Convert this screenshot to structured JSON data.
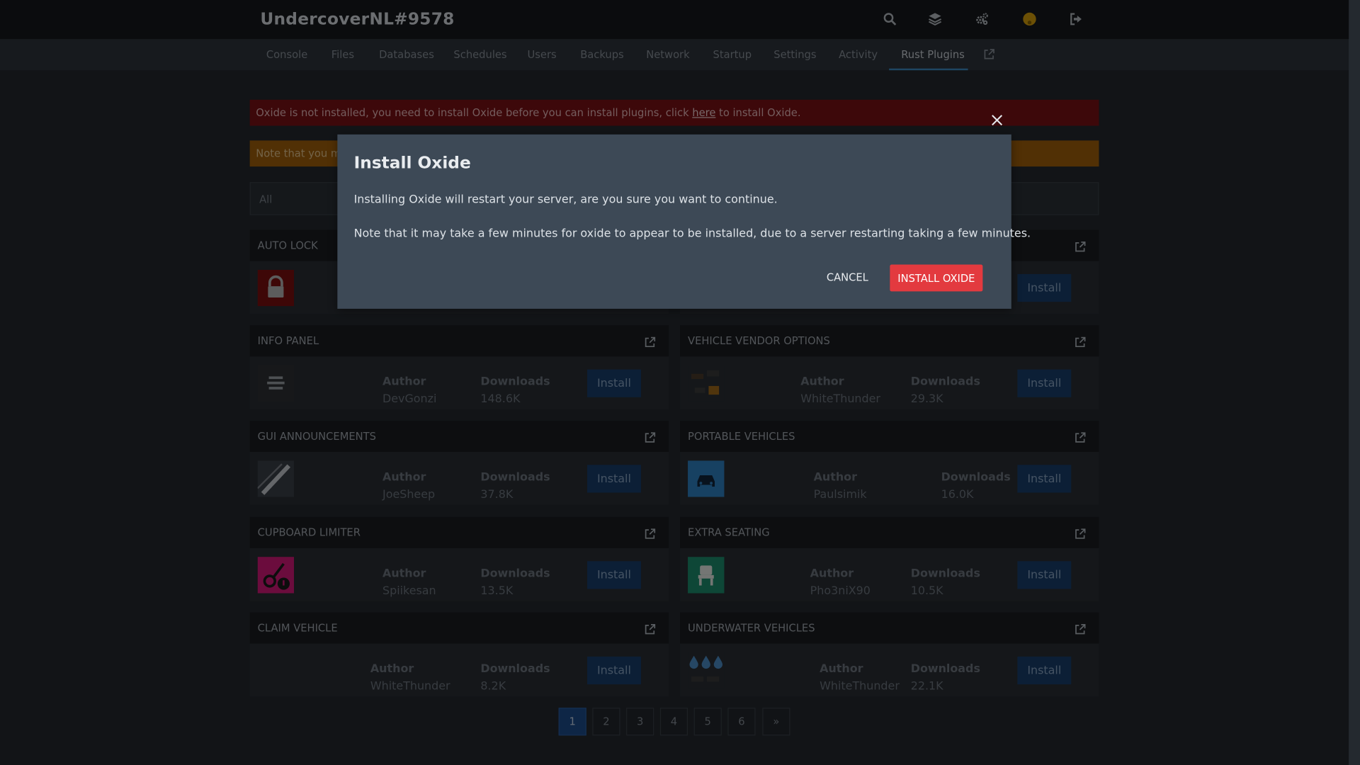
{
  "header": {
    "server_name": "UndercoverNL#9578"
  },
  "nav": {
    "tabs": [
      "Console",
      "Files",
      "Databases",
      "Schedules",
      "Users",
      "Backups",
      "Network",
      "Startup",
      "Settings",
      "Activity",
      "Rust Plugins"
    ],
    "active_tab": "Rust Plugins"
  },
  "alerts": {
    "oxide_before": "Oxide is not installed, you need to install Oxide before you can install plugins, click ",
    "oxide_link": "here",
    "oxide_after": " to install Oxide.",
    "note": "Note that you may"
  },
  "filter": {
    "value": "All"
  },
  "labels": {
    "author": "Author",
    "downloads": "Downloads",
    "install": "Install"
  },
  "plugins": [
    {
      "name": "AUTO LOCK",
      "author": "",
      "downloads": ""
    },
    {
      "name": "",
      "author": "",
      "downloads": ""
    },
    {
      "name": "INFO PANEL",
      "author": "DevGonzi",
      "downloads": "148.6K"
    },
    {
      "name": "VEHICLE VENDOR OPTIONS",
      "author": "WhiteThunder",
      "downloads": "29.3K"
    },
    {
      "name": "GUI ANNOUNCEMENTS",
      "author": "JoeSheep",
      "downloads": "37.8K"
    },
    {
      "name": "PORTABLE VEHICLES",
      "author": "Paulsimik",
      "downloads": "16.0K"
    },
    {
      "name": "CUPBOARD LIMITER",
      "author": "Spiikesan",
      "downloads": "13.5K"
    },
    {
      "name": "EXTRA SEATING",
      "author": "Pho3niX90",
      "downloads": "10.5K"
    },
    {
      "name": "CLAIM VEHICLE",
      "author": "WhiteThunder",
      "downloads": "8.2K"
    },
    {
      "name": "UNDERWATER VEHICLES",
      "author": "WhiteThunder",
      "downloads": "22.1K"
    }
  ],
  "pagination": {
    "pages": [
      "1",
      "2",
      "3",
      "4",
      "5",
      "6"
    ],
    "active": "1",
    "next_label": "»"
  },
  "modal": {
    "title": "Install Oxide",
    "line1": "Installing Oxide will restart your server, are you sure you want to continue.",
    "line2": "Note that it may take a few minutes for oxide to appear to be installed, due to a server restarting taking a few minutes.",
    "cancel_label": "CANCEL",
    "confirm_label": "INSTALL OXIDE"
  },
  "colors": {
    "accent_red": "#e33a3f",
    "install_blue": "#193f6d",
    "active_tab_underline": "#3f8dc5"
  }
}
